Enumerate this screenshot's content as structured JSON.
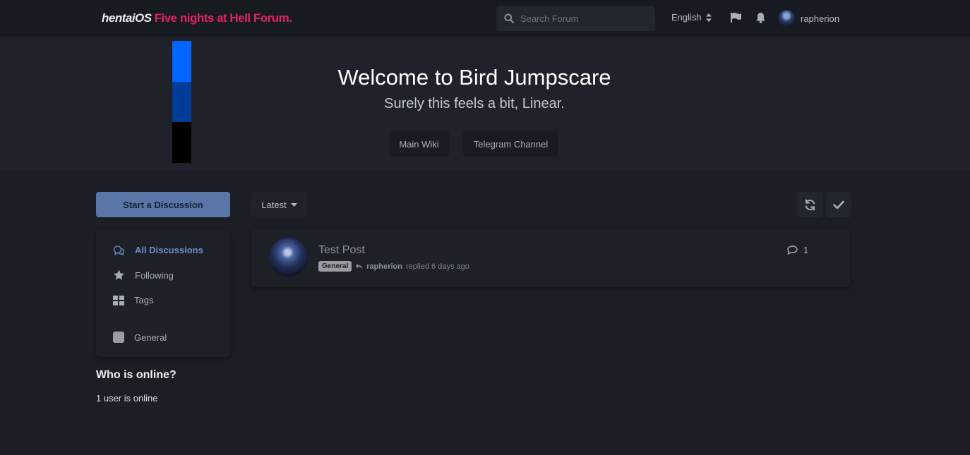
{
  "header": {
    "brand_name": "hentaiOS",
    "forum_name": "Five nights at Hell Forum.",
    "search_placeholder": "Search Forum",
    "language": "English",
    "username": "rapherion"
  },
  "hero": {
    "title": "Welcome to Bird Jumpscare",
    "subtitle": "Surely this feels a bit, Linear.",
    "buttons": [
      {
        "label": "Main Wiki"
      },
      {
        "label": "Telegram Channel"
      }
    ],
    "stripe_colors": [
      "#0066ff",
      "#003d99",
      "#000000"
    ]
  },
  "sidebar": {
    "start_label": "Start a Discussion",
    "nav": [
      {
        "label": "All Discussions",
        "icon": "comments-icon"
      },
      {
        "label": "Following",
        "icon": "star-icon"
      },
      {
        "label": "Tags",
        "icon": "grid-icon"
      },
      {
        "label": "General",
        "icon": "tag-icon"
      }
    ],
    "online_title": "Who is online?",
    "online_text": "1 user is online"
  },
  "toolbar": {
    "sort_label": "Latest"
  },
  "discussions": [
    {
      "title": "Test Post",
      "tag": "General",
      "user": "rapherion",
      "action": "replied 6 days ago",
      "replies": "1"
    }
  ],
  "colors": {
    "accent": "#5a76a6",
    "brand": "#e0245e",
    "background": "#1b1e24"
  }
}
